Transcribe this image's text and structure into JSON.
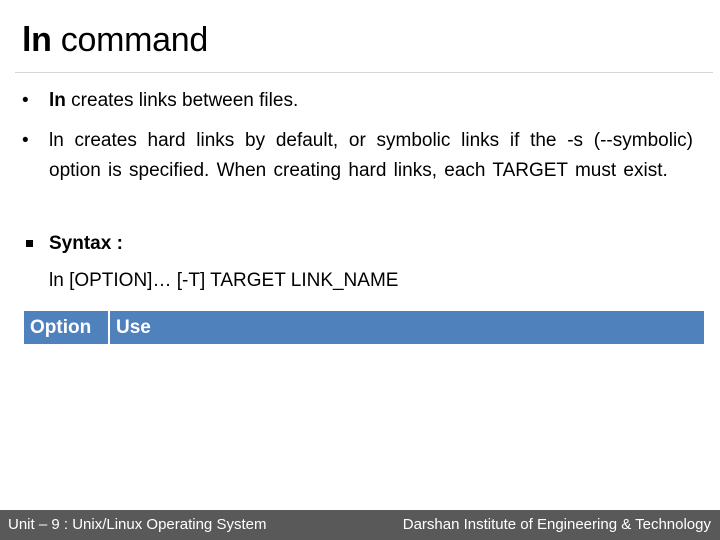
{
  "slide": {
    "title_bold": "ln",
    "title_rest": " command",
    "bullets": [
      {
        "marker": "•",
        "bold": "ln",
        "text": " creates links between files."
      },
      {
        "marker": "•",
        "text": "ln creates hard links by default, or symbolic links if the -s (--symbolic) option is specified. When creating hard links, each TARGET must exist."
      },
      {
        "marker": "square",
        "text": "Syntax :"
      }
    ],
    "syntax": "ln [OPTION]… [-T] TARGET LINK_NAME",
    "table": {
      "headers": [
        "Option",
        "Use"
      ],
      "rows": []
    }
  },
  "footer": {
    "left": "Unit – 9  : Unix/Linux Operating System",
    "right": "Darshan Institute of Engineering & Technology"
  },
  "colors": {
    "table_header": "#4f81bd",
    "footer_bg": "#595959",
    "rule": "#d6d6d6"
  }
}
